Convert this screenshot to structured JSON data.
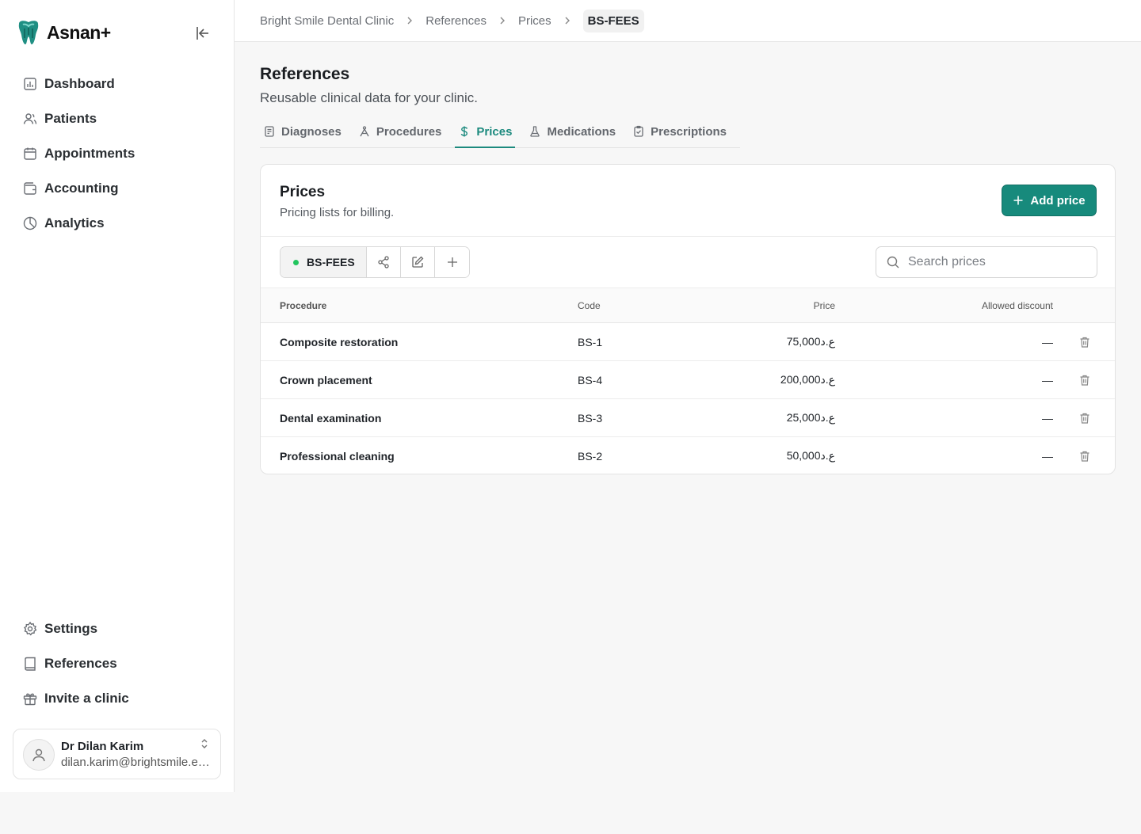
{
  "brand": {
    "name": "Asnan+"
  },
  "sidebar": {
    "nav": [
      {
        "label": "Dashboard",
        "icon": "dashboard-icon"
      },
      {
        "label": "Patients",
        "icon": "users-icon"
      },
      {
        "label": "Appointments",
        "icon": "calendar-icon"
      },
      {
        "label": "Accounting",
        "icon": "wallet-icon"
      },
      {
        "label": "Analytics",
        "icon": "pie-chart-icon"
      }
    ],
    "bottom": [
      {
        "label": "Settings",
        "icon": "gear-icon"
      },
      {
        "label": "References",
        "icon": "book-icon"
      },
      {
        "label": "Invite a clinic",
        "icon": "gift-icon"
      }
    ],
    "user": {
      "name": "Dr Dilan Karim",
      "email": "dilan.karim@brightsmile.example"
    }
  },
  "breadcrumb": [
    "Bright Smile Dental Clinic",
    "References",
    "Prices",
    "BS-FEES"
  ],
  "page": {
    "title": "References",
    "subtitle": "Reusable clinical data for your clinic."
  },
  "tabs": [
    {
      "label": "Diagnoses",
      "icon": "clipboard-list-icon"
    },
    {
      "label": "Procedures",
      "icon": "procedure-icon"
    },
    {
      "label": "Prices",
      "icon": "dollar-icon",
      "active": true
    },
    {
      "label": "Medications",
      "icon": "flask-icon"
    },
    {
      "label": "Prescriptions",
      "icon": "clipboard-check-icon"
    }
  ],
  "card": {
    "title": "Prices",
    "subtitle": "Pricing lists for billing.",
    "add_label": "Add price",
    "list_name": "BS-FEES",
    "search_placeholder": "Search prices"
  },
  "table": {
    "columns": {
      "procedure": "Procedure",
      "code": "Code",
      "price": "Price",
      "discount": "Allowed discount"
    },
    "rows": [
      {
        "procedure": "Composite restoration",
        "code": "BS-1",
        "price": "75,000ع.د",
        "discount": "—"
      },
      {
        "procedure": "Crown placement",
        "code": "BS-4",
        "price": "200,000ع.د",
        "discount": "—"
      },
      {
        "procedure": "Dental examination",
        "code": "BS-3",
        "price": "25,000ع.د",
        "discount": "—"
      },
      {
        "procedure": "Professional cleaning",
        "code": "BS-2",
        "price": "50,000ع.د",
        "discount": "—"
      }
    ]
  },
  "colors": {
    "accent": "#178a7c",
    "status_dot": "#22c55e"
  }
}
